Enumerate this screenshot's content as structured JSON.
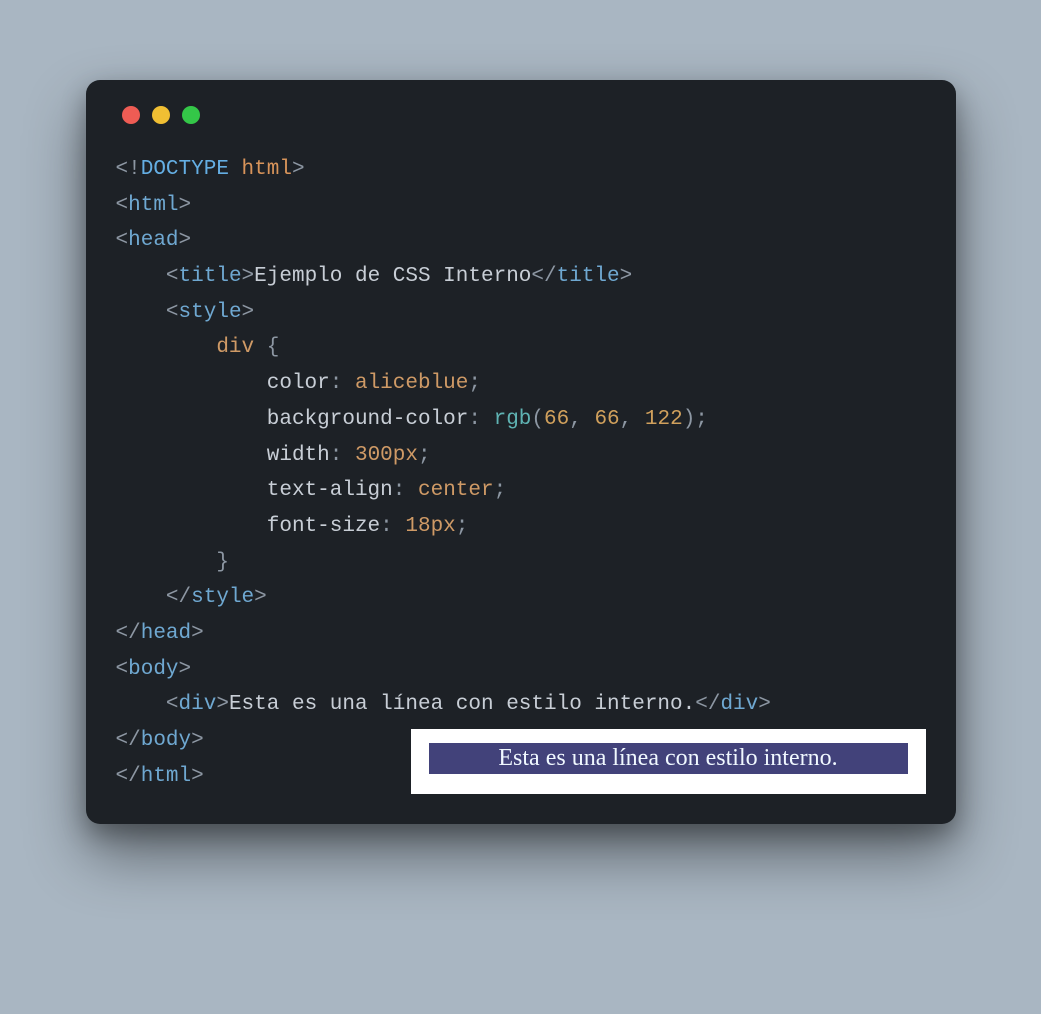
{
  "traffic": {
    "red": "#ee5c54",
    "yellow": "#f0bf33",
    "green": "#34c748"
  },
  "code": {
    "l1": {
      "doctype": "DOCTYPE",
      "html": "html"
    },
    "l2": {
      "tag": "html"
    },
    "l3": {
      "tag": "head"
    },
    "l4": {
      "tag_open": "title",
      "text": "Ejemplo de CSS Interno",
      "tag_close": "title"
    },
    "l5": {
      "tag": "style"
    },
    "l6": {
      "selector": "div",
      "brace": "{"
    },
    "l7": {
      "prop": "color",
      "val": "aliceblue"
    },
    "l8": {
      "prop": "background-color",
      "func": "rgb",
      "args": [
        "66",
        "66",
        "122"
      ]
    },
    "l9": {
      "prop": "width",
      "val": "300px"
    },
    "l10": {
      "prop": "text-align",
      "val": "center"
    },
    "l11": {
      "prop": "font-size",
      "val": "18px"
    },
    "l12": {
      "brace": "}"
    },
    "l13": {
      "tag": "style"
    },
    "l14": {
      "tag": "head"
    },
    "l15": {
      "tag": "body"
    },
    "l16": {
      "tag_open": "div",
      "text": "Esta es una línea con estilo interno.",
      "tag_close": "div"
    },
    "l17": {
      "tag": "body"
    },
    "l18": {
      "tag": "html"
    }
  },
  "preview": {
    "text": "Esta es una línea con estilo interno.",
    "bg": "rgb(66, 66, 122)",
    "color": "aliceblue"
  }
}
